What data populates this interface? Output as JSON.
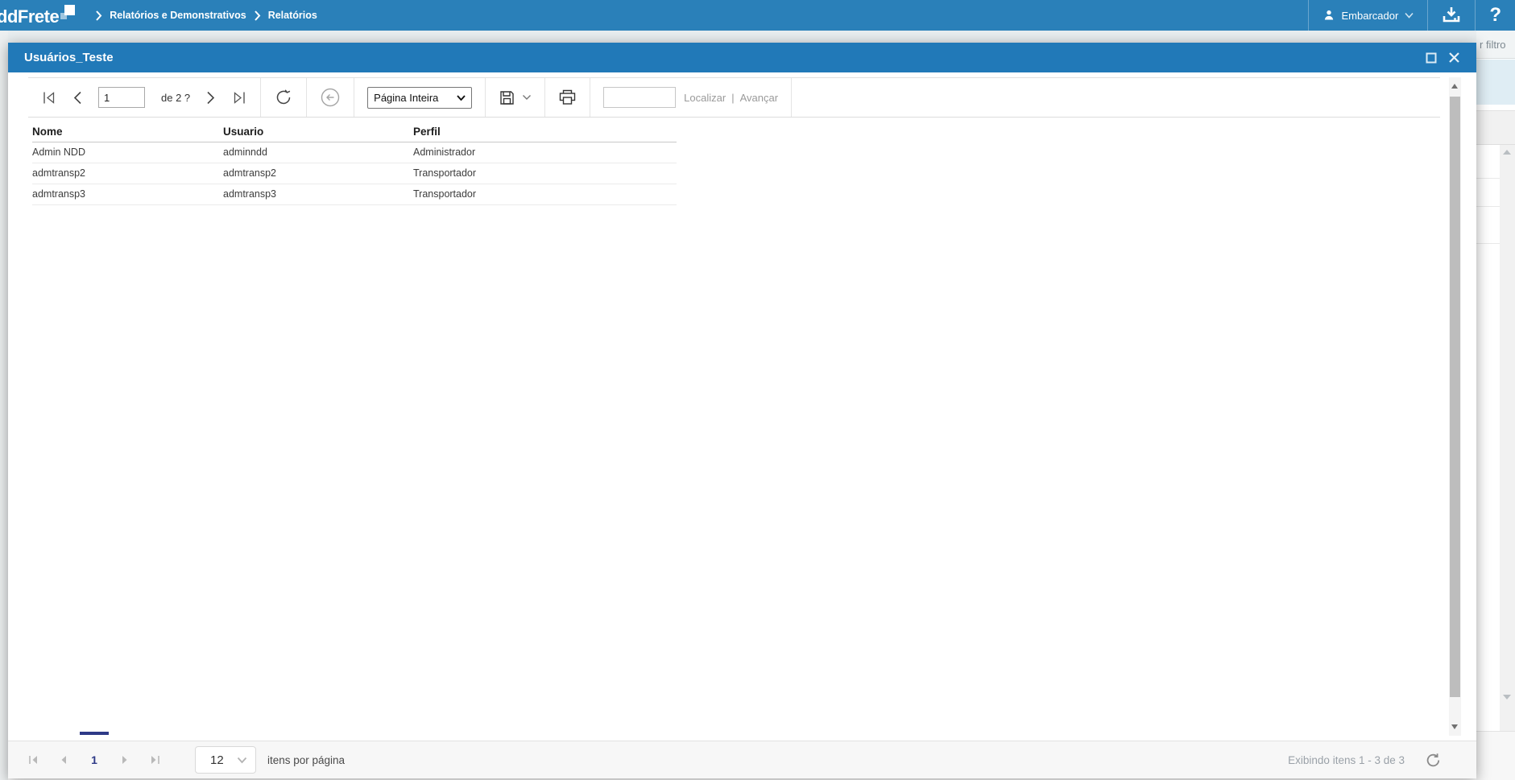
{
  "colors": {
    "topbar_blue": "#2a80b9",
    "modal_header_blue": "#2179b8",
    "pager_accent_navy": "#2e3a87"
  },
  "topbar": {
    "logo_text": "ddFrete",
    "breadcrumbs": [
      {
        "label": "Relatórios e Demonstrativos"
      },
      {
        "label": "Relatórios"
      }
    ],
    "user_menu_label": "Embarcador",
    "help_glyph": "?"
  },
  "background": {
    "filter_label_partial": "r filtro"
  },
  "modal": {
    "title": "Usuários_Teste",
    "toolbar": {
      "page_input_value": "1",
      "page_total_label": "de 2 ?",
      "zoom_select_value": "Página Inteira",
      "find_input_value": "",
      "find_label": "Localizar",
      "find_separator": "|",
      "find_next_label": "Avançar"
    },
    "table": {
      "headers": [
        "Nome",
        "Usuario",
        "Perfil"
      ],
      "rows": [
        [
          "Admin NDD",
          "adminndd",
          "Administrador"
        ],
        [
          "admtransp2",
          "admtransp2",
          "Transportador"
        ],
        [
          "admtransp3",
          "admtransp3",
          "Transportador"
        ]
      ]
    },
    "footer": {
      "current_page": "1",
      "page_size_value": "12",
      "items_per_page_label": "itens por página",
      "status_text": "Exibindo itens 1 - 3 de 3"
    }
  }
}
